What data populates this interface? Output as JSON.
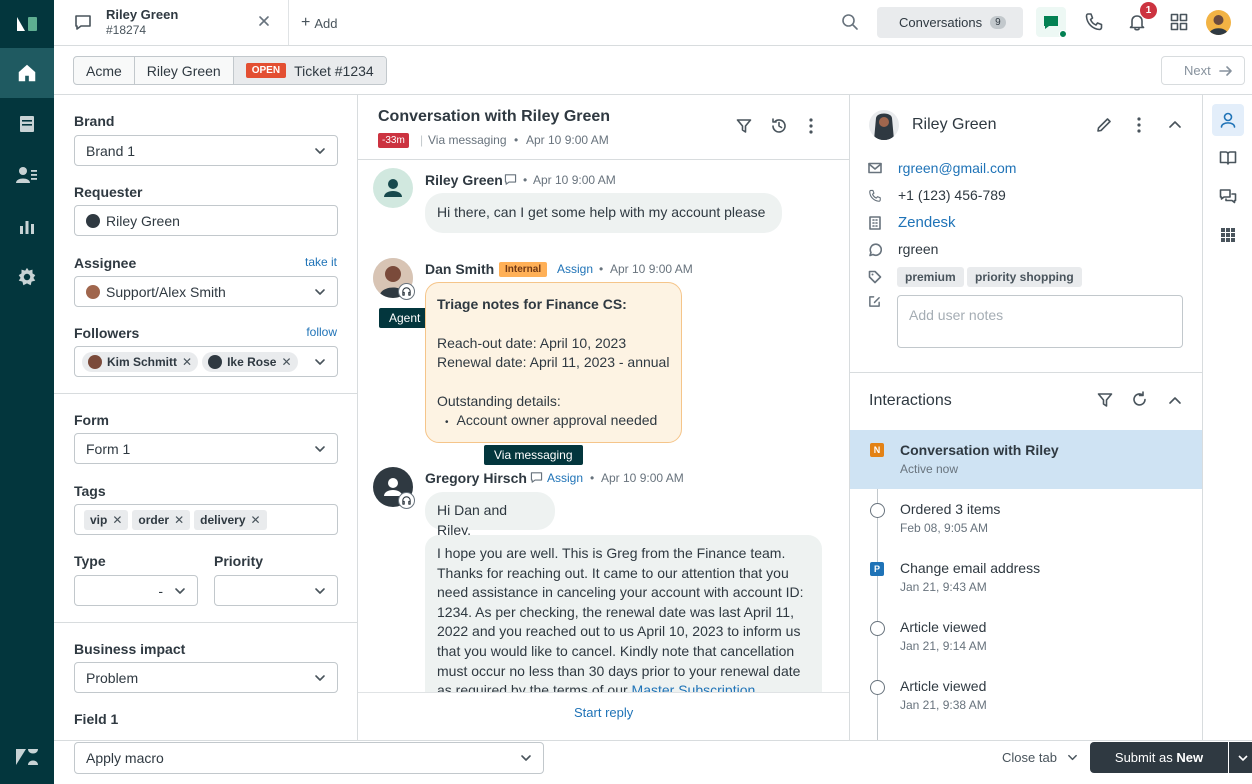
{
  "tab": {
    "name": "Riley Green",
    "number": "#18274",
    "add_label": "Add"
  },
  "topbar": {
    "conversations_label": "Conversations",
    "conversations_count": "9",
    "notification_count": "1"
  },
  "breadcrumbs": {
    "org": "Acme",
    "requester": "Riley Green",
    "status": "OPEN",
    "ticket": "Ticket #1234"
  },
  "next_label": "Next",
  "left": {
    "brand_label": "Brand",
    "brand_value": "Brand 1",
    "requester_label": "Requester",
    "requester_value": "Riley Green",
    "assignee_label": "Assignee",
    "assignee_link": "take it",
    "assignee_value": "Support/Alex Smith",
    "followers_label": "Followers",
    "followers_link": "follow",
    "followers": [
      "Kim Schmitt",
      "Ike Rose"
    ],
    "form_label": "Form",
    "form_value": "Form 1",
    "tags_label": "Tags",
    "tags": [
      "vip",
      "order",
      "delivery"
    ],
    "type_label": "Type",
    "type_value": "-",
    "priority_label": "Priority",
    "impact_label": "Business impact",
    "impact_value": "Problem",
    "field1_label": "Field 1"
  },
  "conversation": {
    "title": "Conversation with Riley Green",
    "sla": "-33m",
    "channel": "Via messaging",
    "time": "Apr 10 9:00 AM",
    "messages": [
      {
        "sender": "Riley Green",
        "time": "Apr 10 9:00 AM",
        "text": "Hi there, can I get some help with my account please"
      },
      {
        "sender": "Dan Smith",
        "badge": "Internal",
        "assign": "Assign",
        "time": "Apr 10 9:00 AM",
        "tooltip": "Agent",
        "note_title": "Triage notes for Finance CS:",
        "note_line1": "Reach-out date: April 10, 2023",
        "note_line2": "Renewal date: April 11, 2023 - annual",
        "note_line3": "Outstanding details:",
        "note_bullet": "Account owner approval needed"
      },
      {
        "sender": "Gregory Hirsch",
        "assign": "Assign",
        "time": "Apr 10 9:00 AM",
        "tooltip": "Via messaging",
        "greeting": "Hi Dan and Riley.",
        "body": "I hope you are well. This is Greg from the Finance team. Thanks for reaching out. It came to our attention that you need assistance in canceling your account with account ID: 1234. As per checking, the renewal date was last April 11, 2022 and you reached out to us April 10, 2023 to inform us that you would like to cancel. Kindly note that cancellation must occur no less than 30 days prior to your renewal date as required by the terms of our",
        "body_link": "Master Subscription"
      }
    ],
    "start_reply": "Start reply"
  },
  "customer": {
    "name": "Riley Green",
    "email": "rgreen@gmail.com",
    "phone": "+1 (123) 456-789",
    "org": "Zendesk",
    "handle": "rgreen",
    "tags": [
      "premium",
      "priority shopping"
    ],
    "notes_placeholder": "Add user notes"
  },
  "interactions": {
    "title": "Interactions",
    "items": [
      {
        "badge": "N",
        "title": "Conversation with Riley",
        "sub": "Active now"
      },
      {
        "title": "Ordered 3 items",
        "sub": "Feb 08, 9:05 AM"
      },
      {
        "badge": "P",
        "title": "Change email address",
        "sub": "Jan 21, 9:43 AM"
      },
      {
        "title": "Article viewed",
        "sub": "Jan 21, 9:14 AM"
      },
      {
        "title": "Article viewed",
        "sub": "Jan 21, 9:38 AM"
      }
    ]
  },
  "bottom": {
    "macro": "Apply macro",
    "close_tab": "Close tab",
    "submit_prefix": "Submit as",
    "submit_status": "New"
  },
  "colors": {
    "nav": "#03363d",
    "accent": "#1f73b7",
    "open": "#e34f32",
    "brand_green": "#17494d",
    "selected": "#cfe3f3"
  }
}
